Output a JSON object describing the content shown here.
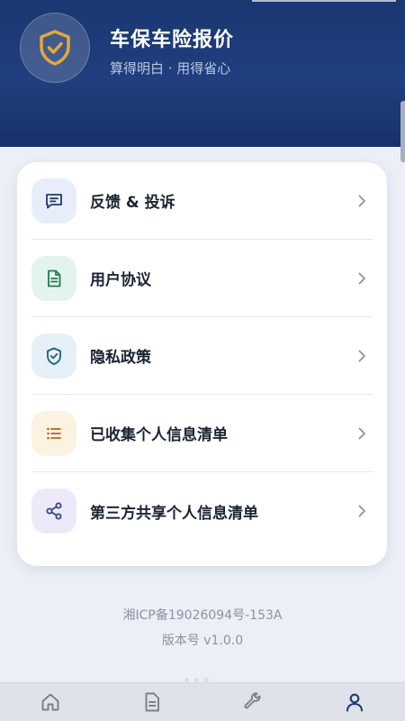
{
  "header": {
    "title": "车保车险报价",
    "subtitle": "算得明白 · 用得省心",
    "logo_icon": "shield-check-icon"
  },
  "menu": {
    "items": [
      {
        "label": "反馈 & 投诉",
        "icon": "feedback-icon",
        "icon_bg": "#e8eef9",
        "icon_color": "#1f3a73"
      },
      {
        "label": "用户协议",
        "icon": "document-icon",
        "icon_bg": "#e3f4ec",
        "icon_color": "#1f7a52"
      },
      {
        "label": "隐私政策",
        "icon": "shield-check-icon",
        "icon_bg": "#e5f0f8",
        "icon_color": "#1f5e74"
      },
      {
        "label": "已收集个人信息清单",
        "icon": "list-icon",
        "icon_bg": "#fbf2e2",
        "icon_color": "#b8641a"
      },
      {
        "label": "第三方共享个人信息清单",
        "icon": "share-icon",
        "icon_bg": "#eceaf8",
        "icon_color": "#3a3f8a"
      }
    ]
  },
  "footer": {
    "icp": "湘ICP备19026094号-153A",
    "version": "版本号 v1.0.0"
  },
  "tabbar": {
    "tabs": [
      {
        "icon": "home-icon",
        "active": false
      },
      {
        "icon": "document-icon",
        "active": false
      },
      {
        "icon": "wrench-icon",
        "active": false
      },
      {
        "icon": "user-icon",
        "active": true
      }
    ]
  },
  "colors": {
    "header_bg": "#1f3a73",
    "accent_gold": "#e2a93a",
    "tab_active": "#1f3a73",
    "tab_inactive": "#7a808c"
  }
}
